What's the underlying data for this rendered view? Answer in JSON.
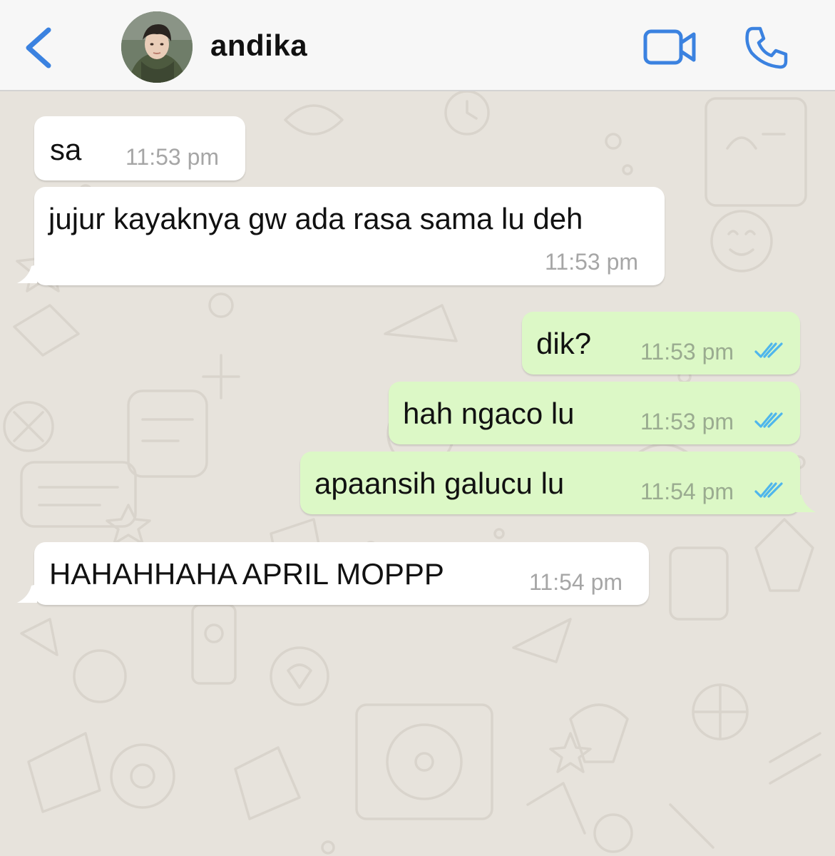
{
  "header": {
    "back_icon": "chevron-left-icon",
    "contact_name": "andika",
    "video_icon": "video-camera-icon",
    "call_icon": "phone-icon",
    "accent_color": "#3b82e0"
  },
  "messages": [
    {
      "direction": "incoming",
      "text": "sa",
      "time": "11:53 pm"
    },
    {
      "direction": "incoming",
      "text": "jujur kayaknya gw ada rasa sama lu deh",
      "time": "11:53 pm"
    },
    {
      "direction": "outgoing",
      "text": "dik?",
      "time": "11:53 pm",
      "status": "read"
    },
    {
      "direction": "outgoing",
      "text": "hah ngaco lu",
      "time": "11:53 pm",
      "status": "read"
    },
    {
      "direction": "outgoing",
      "text": "apaansih galucu lu",
      "time": "11:54 pm",
      "status": "read"
    },
    {
      "direction": "incoming",
      "text": "HAHAHHAHA APRIL MOPPP",
      "time": "11:54 pm"
    }
  ],
  "colors": {
    "incoming_bubble": "#ffffff",
    "outgoing_bubble": "#dcf8c6",
    "read_ticks": "#4fb6ec",
    "wallpaper": "#e7e3dc"
  }
}
